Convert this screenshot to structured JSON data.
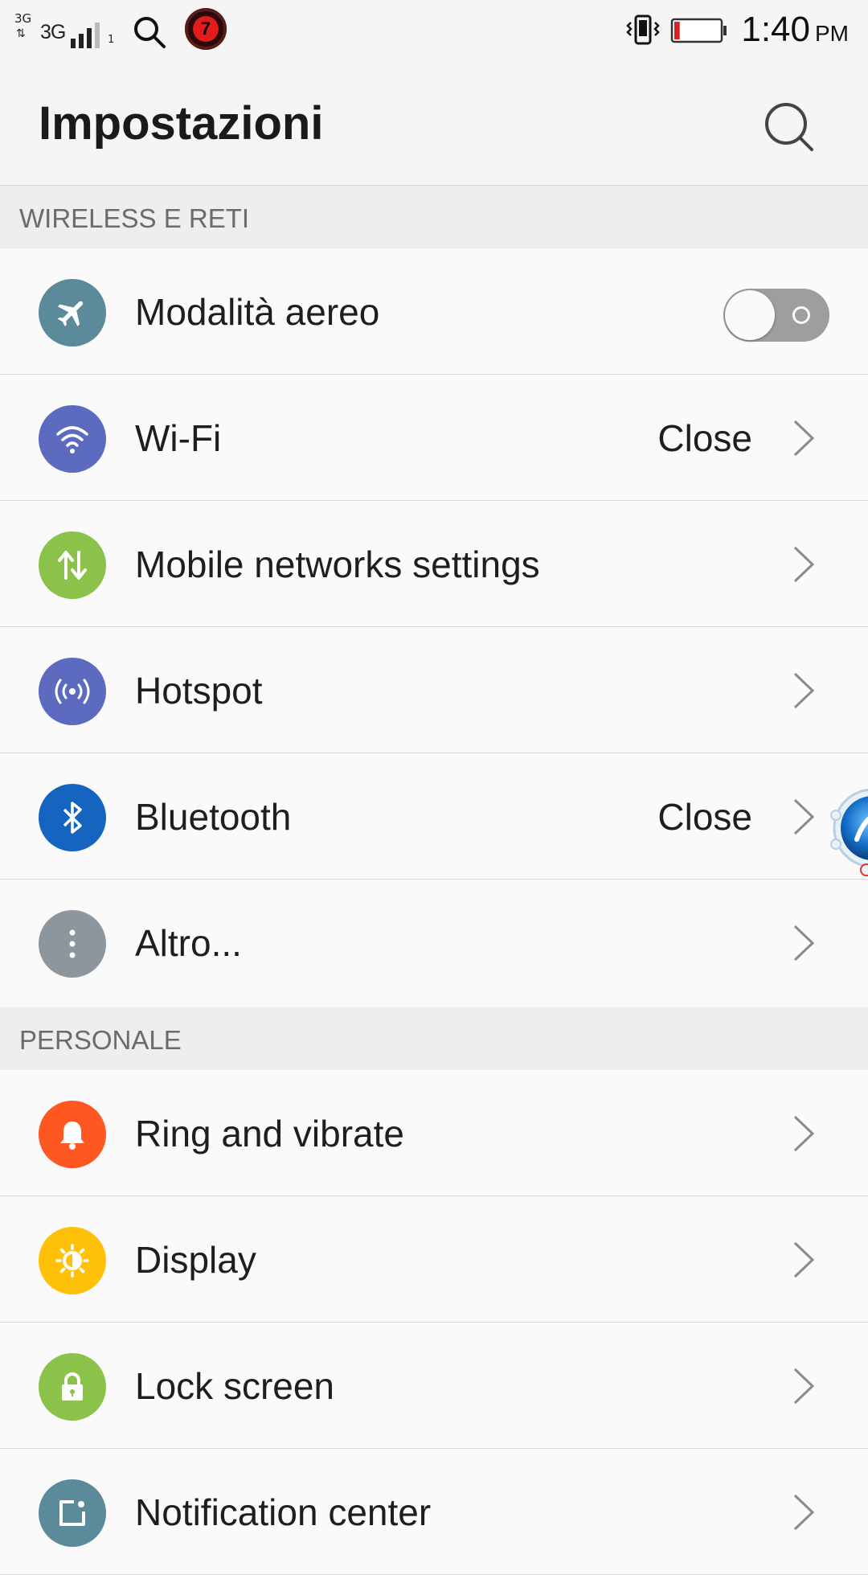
{
  "status_bar": {
    "network_small": "3G",
    "network_main": "3G",
    "sim_label": "1",
    "notification_badge": "7",
    "time": "1:40",
    "ampm": "PM",
    "battery_level": 0.12
  },
  "header": {
    "title": "Impostazioni",
    "search_icon": "search-icon"
  },
  "sections": [
    {
      "title": "WIRELESS E RETI",
      "items": [
        {
          "label": "Modalità aereo",
          "icon": "airplane-icon",
          "color": "#5b8a9a",
          "toggle": false
        },
        {
          "label": "Wi-Fi",
          "icon": "wifi-icon",
          "color": "#5c6bc0",
          "value": "Close"
        },
        {
          "label": "Mobile networks settings",
          "icon": "data-transfer-icon",
          "color": "#8bc34a"
        },
        {
          "label": "Hotspot",
          "icon": "hotspot-icon",
          "color": "#5c6bc0"
        },
        {
          "label": "Bluetooth",
          "icon": "bluetooth-icon",
          "color": "#1565c0",
          "value": "Close"
        },
        {
          "label": "Altro...",
          "icon": "more-vert-icon",
          "color": "#8e969d"
        }
      ]
    },
    {
      "title": "PERSONALE",
      "items": [
        {
          "label": "Ring and vibrate",
          "icon": "bell-icon",
          "color": "#ff5722"
        },
        {
          "label": "Display",
          "icon": "brightness-icon",
          "color": "#ffc107"
        },
        {
          "label": "Lock screen",
          "icon": "lock-icon",
          "color": "#8bc34a"
        },
        {
          "label": "Notification center",
          "icon": "notification-icon",
          "color": "#5b8a9a"
        }
      ]
    }
  ]
}
